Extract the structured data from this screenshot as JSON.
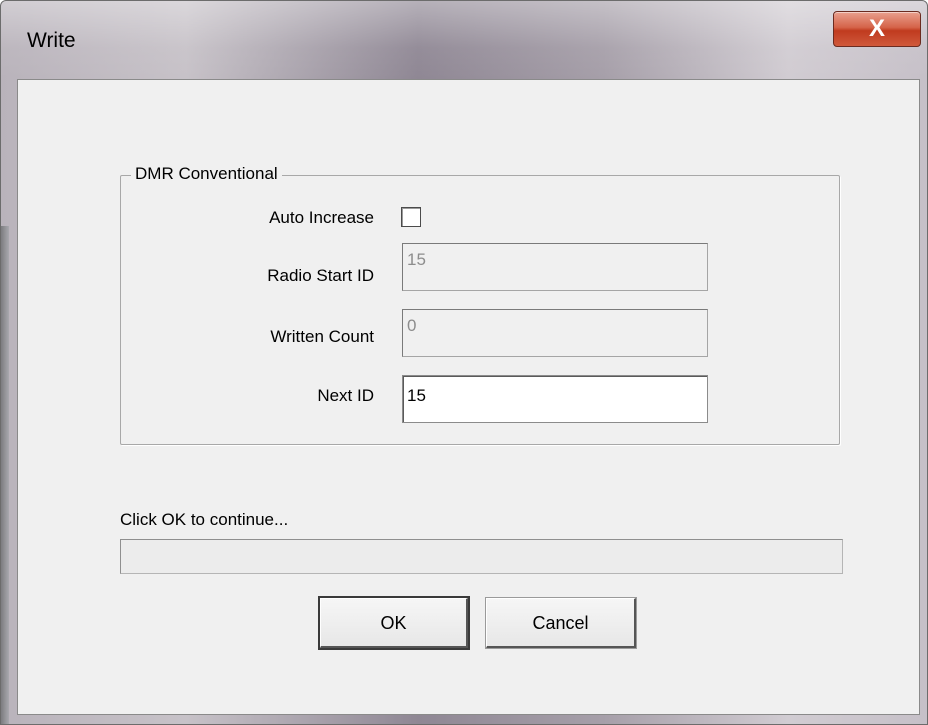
{
  "window": {
    "title": "Write",
    "close_glyph": "X"
  },
  "group": {
    "legend": "DMR Conventional",
    "auto_increase": {
      "label": "Auto Increase",
      "checked": false
    },
    "radio_start_id": {
      "label": "Radio Start ID",
      "value": "15",
      "enabled": false
    },
    "written_count": {
      "label": "Written Count",
      "value": "0",
      "enabled": false
    },
    "next_id": {
      "label": "Next ID",
      "value": "15",
      "enabled": true
    }
  },
  "status": {
    "message": "Click OK to continue...",
    "progress_percent": 0
  },
  "buttons": {
    "ok_label": "OK",
    "cancel_label": "Cancel"
  },
  "colors": {
    "close_button": "#c8432a",
    "dialog_face": "#f0f0f0"
  }
}
